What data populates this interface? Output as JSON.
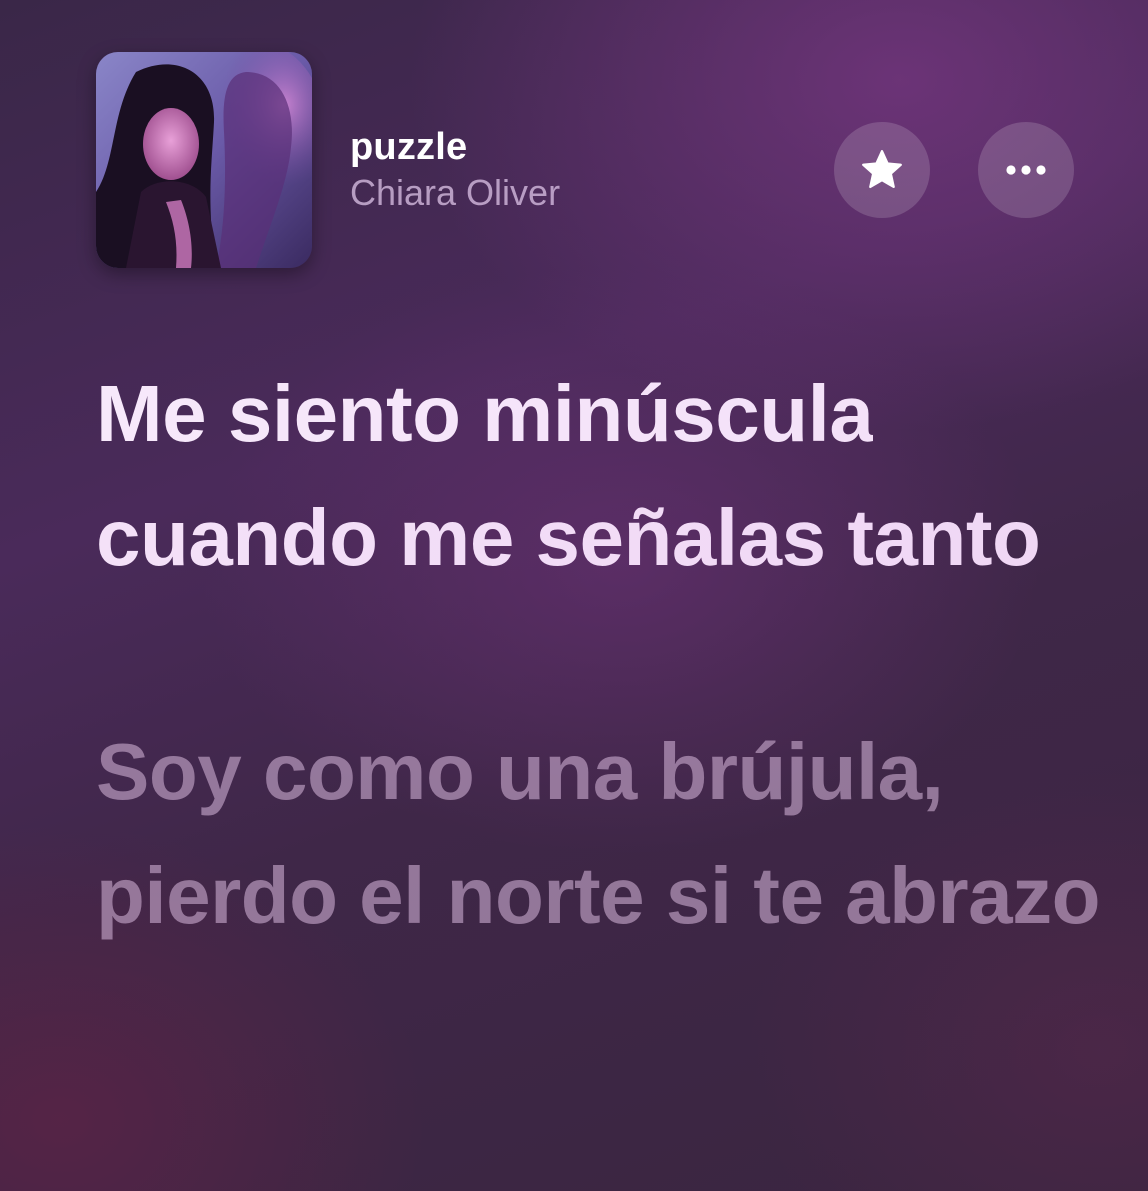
{
  "now_playing": {
    "title": "puzzle",
    "artist": "Chiara Oliver",
    "artwork": "album-artwork",
    "favorite_icon": "star-icon",
    "more_icon": "ellipsis-icon"
  },
  "lyrics": {
    "current_line": "Me siento minúscula cuando me señalas tanto",
    "next_line": "Soy como una brújula, pierdo el norte si te abrazo"
  },
  "colors": {
    "current_lyric": "#ffffff",
    "upcoming_lyric": "#c8aacd",
    "artist_text": "#d7bee1"
  }
}
